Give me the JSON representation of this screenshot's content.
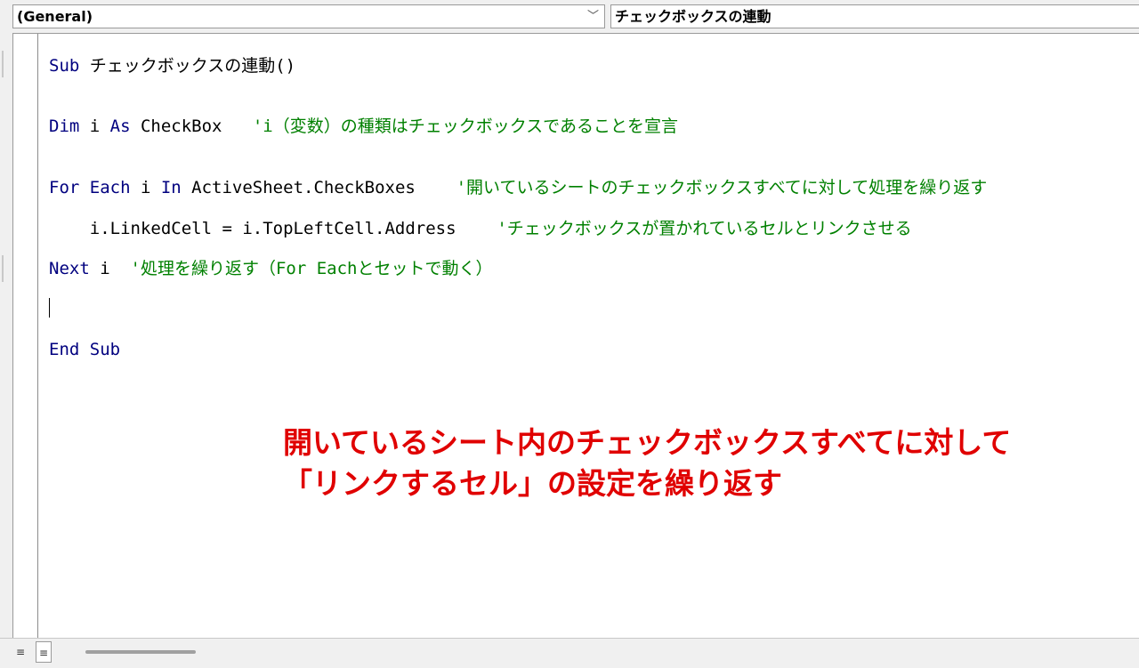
{
  "object_combo": {
    "value": "(General)",
    "arrow": "﹀"
  },
  "procedure_combo": {
    "value": "チェックボックスの連動"
  },
  "code": {
    "line1_kw": "Sub",
    "line1_rest": " チェックボックスの連動()",
    "line2_kw1": "Dim",
    "line2_mid1": " i ",
    "line2_kw2": "As",
    "line2_mid2": " CheckBox   ",
    "line2_comment": "'i（変数）の種類はチェックボックスであることを宣言",
    "line3_kw1": "For Each",
    "line3_mid1": " i ",
    "line3_kw2": "In",
    "line3_mid2": " ActiveSheet.CheckBoxes    ",
    "line3_comment": "'開いているシートのチェックボックスすべてに対して処理を繰り返す",
    "line4_code": "    i.LinkedCell = i.TopLeftCell.Address    ",
    "line4_comment": "'チェックボックスが置かれているセルとリンクさせる",
    "line5_kw": "Next",
    "line5_mid": " i  ",
    "line5_comment": "'処理を繰り返す（For Eachとセットで動く）",
    "line7_kw": "End Sub"
  },
  "annotation": {
    "line1": "開いているシート内のチェックボックスすべてに対して",
    "line2": "「リンクするセル」の設定を繰り返す"
  },
  "view_buttons": {
    "procedure": "≡",
    "full_module": "≡"
  },
  "colors": {
    "keyword": "#00007f",
    "comment": "#008000",
    "annotation": "#e00000"
  }
}
